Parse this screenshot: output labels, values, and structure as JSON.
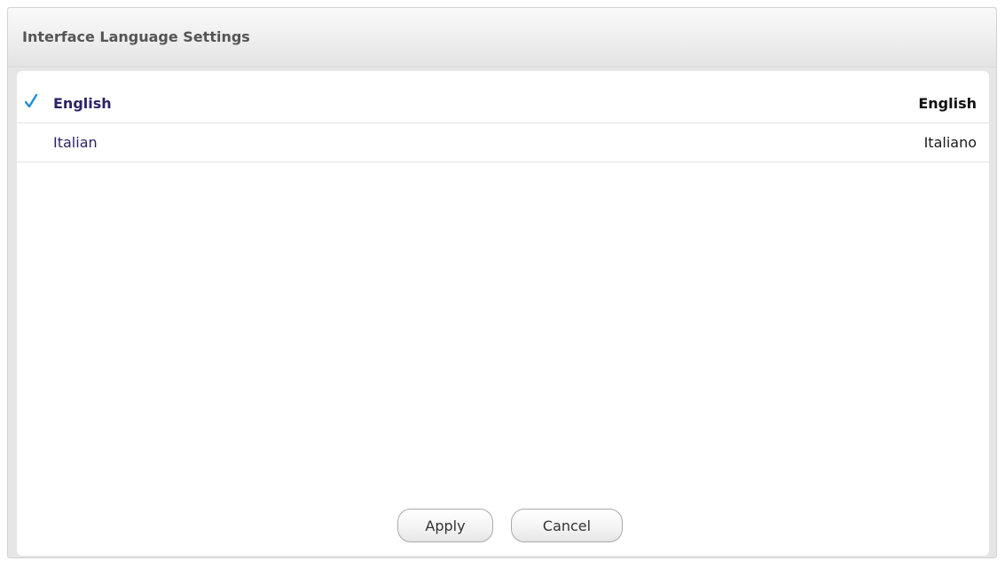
{
  "dialog": {
    "title": "Interface Language Settings"
  },
  "languages": [
    {
      "name": "English",
      "native": "English",
      "selected": true
    },
    {
      "name": "Italian",
      "native": "Italiano",
      "selected": false
    }
  ],
  "icons": {
    "selected_marker": "checkmark-icon"
  },
  "colors": {
    "checkmark": "#1e8fd6",
    "language_name": "#2d2266"
  },
  "buttons": {
    "apply_label": "Apply",
    "cancel_label": "Cancel"
  }
}
